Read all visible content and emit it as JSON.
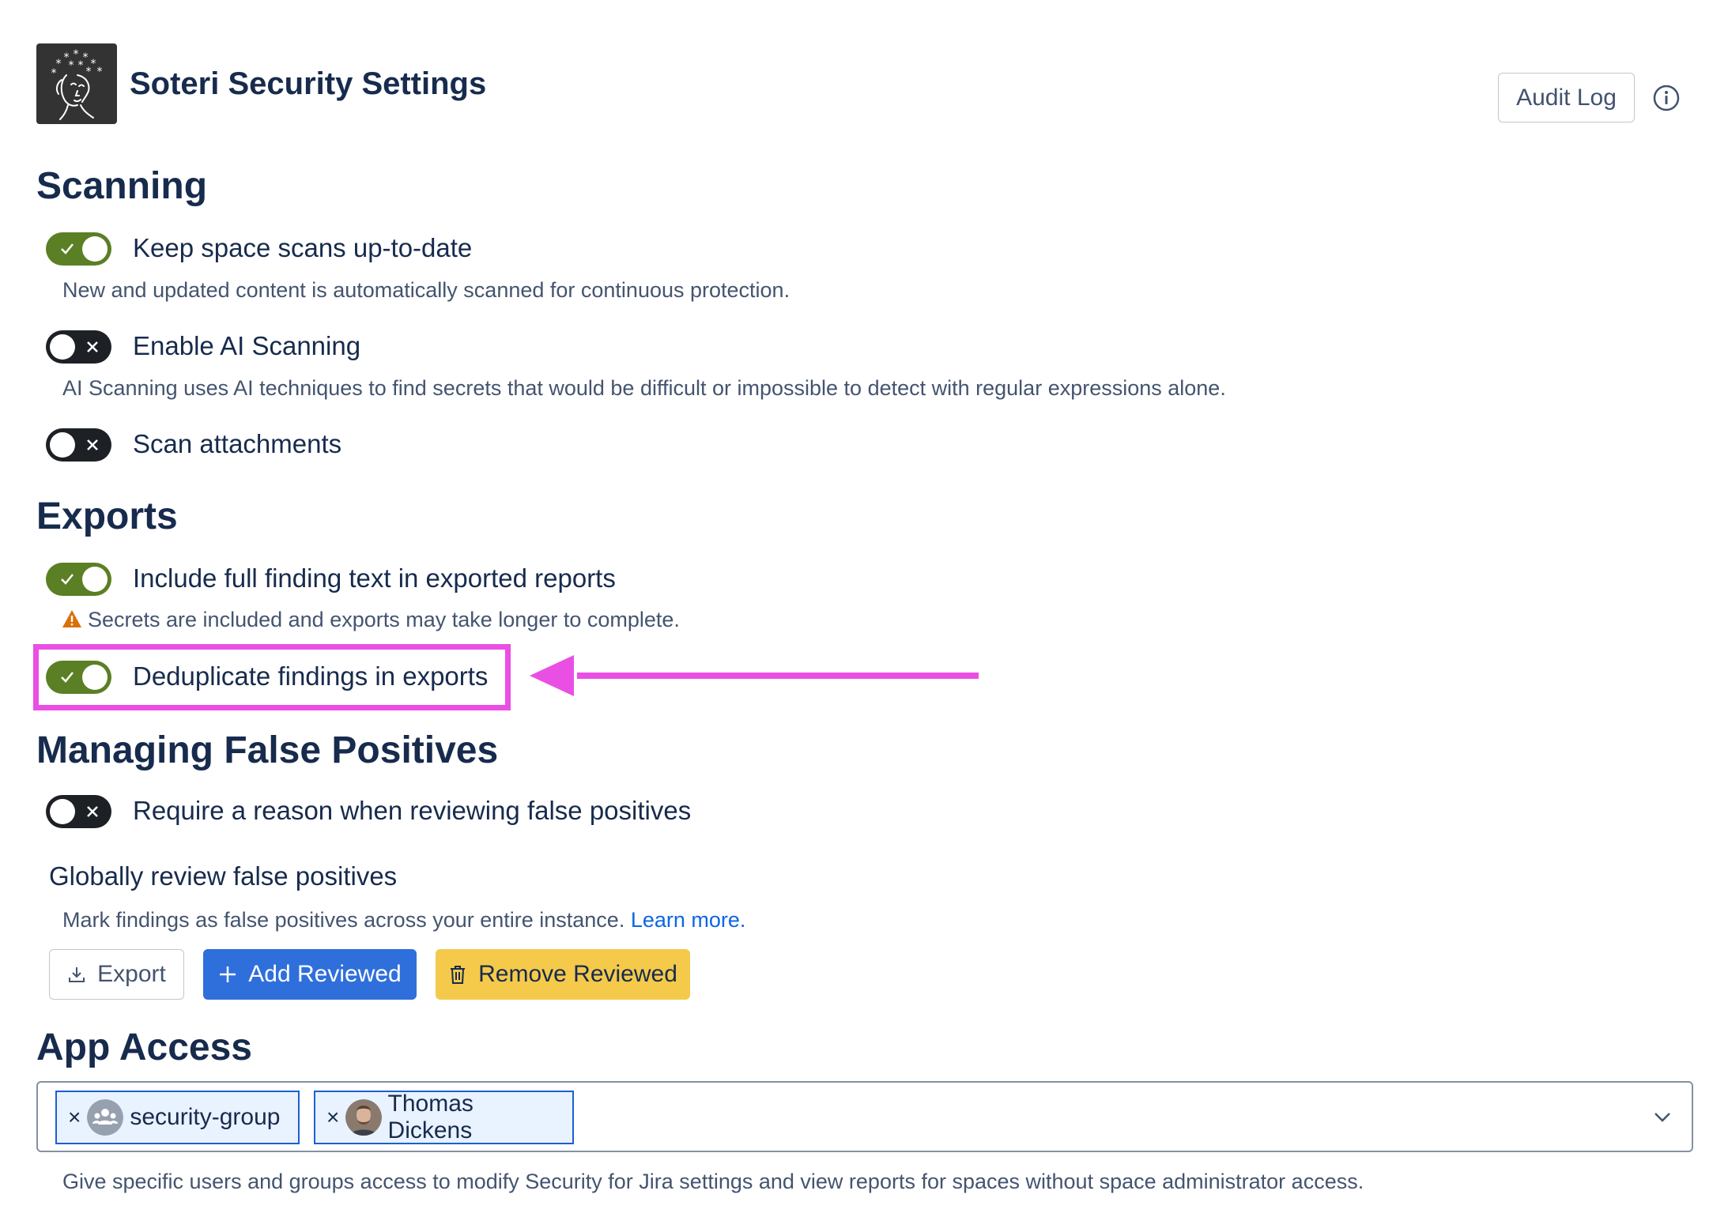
{
  "header": {
    "title": "Soteri Security Settings",
    "audit_log_label": "Audit Log",
    "info_icon": "info-icon"
  },
  "scanning": {
    "heading": "Scanning",
    "items": [
      {
        "label": "Keep space scans up-to-date",
        "enabled": true,
        "description": "New and updated content is automatically scanned for continuous protection."
      },
      {
        "label": "Enable AI Scanning",
        "enabled": false,
        "description": "AI Scanning uses AI techniques to find secrets that would be difficult or impossible to detect with regular expressions alone."
      },
      {
        "label": "Scan attachments",
        "enabled": false
      }
    ]
  },
  "exports": {
    "heading": "Exports",
    "items": [
      {
        "label": "Include full finding text in exported reports",
        "enabled": true,
        "warning": "Secrets are included and exports may take longer to complete."
      },
      {
        "label": "Deduplicate findings in exports",
        "enabled": true
      }
    ]
  },
  "false_positives": {
    "heading": "Managing False Positives",
    "require_reason_label": "Require a reason when reviewing false positives",
    "require_reason_enabled": false,
    "global_title": "Globally review false positives",
    "global_description": "Mark findings as false positives across your entire instance.",
    "learn_more": "Learn more.",
    "buttons": {
      "export": "Export",
      "add_reviewed": "Add Reviewed",
      "remove_reviewed": "Remove Reviewed"
    }
  },
  "app_access": {
    "heading": "App Access",
    "chips": [
      {
        "label": "security-group",
        "type": "group"
      },
      {
        "label": "Thomas Dickens",
        "type": "user"
      }
    ],
    "remove_glyph": "×",
    "description": "Give specific users and groups access to modify Security for Jira settings and view reports for spaces without space administrator access."
  },
  "colors": {
    "toggle_on": "#5b7f24",
    "toggle_off": "#1d2125",
    "primary": "#2f6fdc",
    "warning_button": "#f5c94a",
    "highlight": "#ea4fe4",
    "link": "#0c66e4"
  }
}
